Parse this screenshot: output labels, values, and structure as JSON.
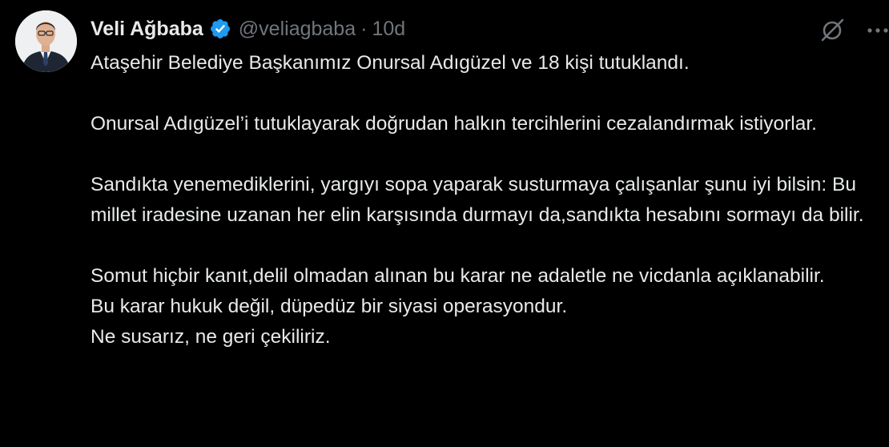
{
  "author": {
    "display_name": "Veli Ağbaba",
    "handle": "@veliagbaba",
    "separator": "·",
    "time": "10d",
    "verified_color": "#1d9bf0"
  },
  "icons": {
    "verified": "verified-badge-icon",
    "grok": "grok-icon",
    "more": "more-options-icon"
  },
  "tweet": {
    "lines": [
      "Ataşehir Belediye Başkanımız Onursal Adıgüzel ve 18 kişi tutuklandı.",
      "Onursal Adıgüzel’i tutuklayarak  doğrudan halkın tercihlerini cezalandırmak istiyorlar.",
      "Sandıkta yenemediklerini, yargıyı sopa yaparak susturmaya çalışanlar şunu iyi bilsin: Bu millet iradesine uzanan her elin karşısında durmayı da,sandıkta hesabını sormayı da bilir.",
      "Somut hiçbir kanıt,delil olmadan alınan bu karar ne adaletle ne vicdanla açıklanabilir.",
      "Bu karar hukuk değil, düpedüz bir siyasi operasyondur.",
      "Ne susarız, ne geri çekiliriz."
    ]
  },
  "colors": {
    "background": "#000000",
    "text_primary": "#e7e9ea",
    "text_secondary": "#71767b"
  }
}
